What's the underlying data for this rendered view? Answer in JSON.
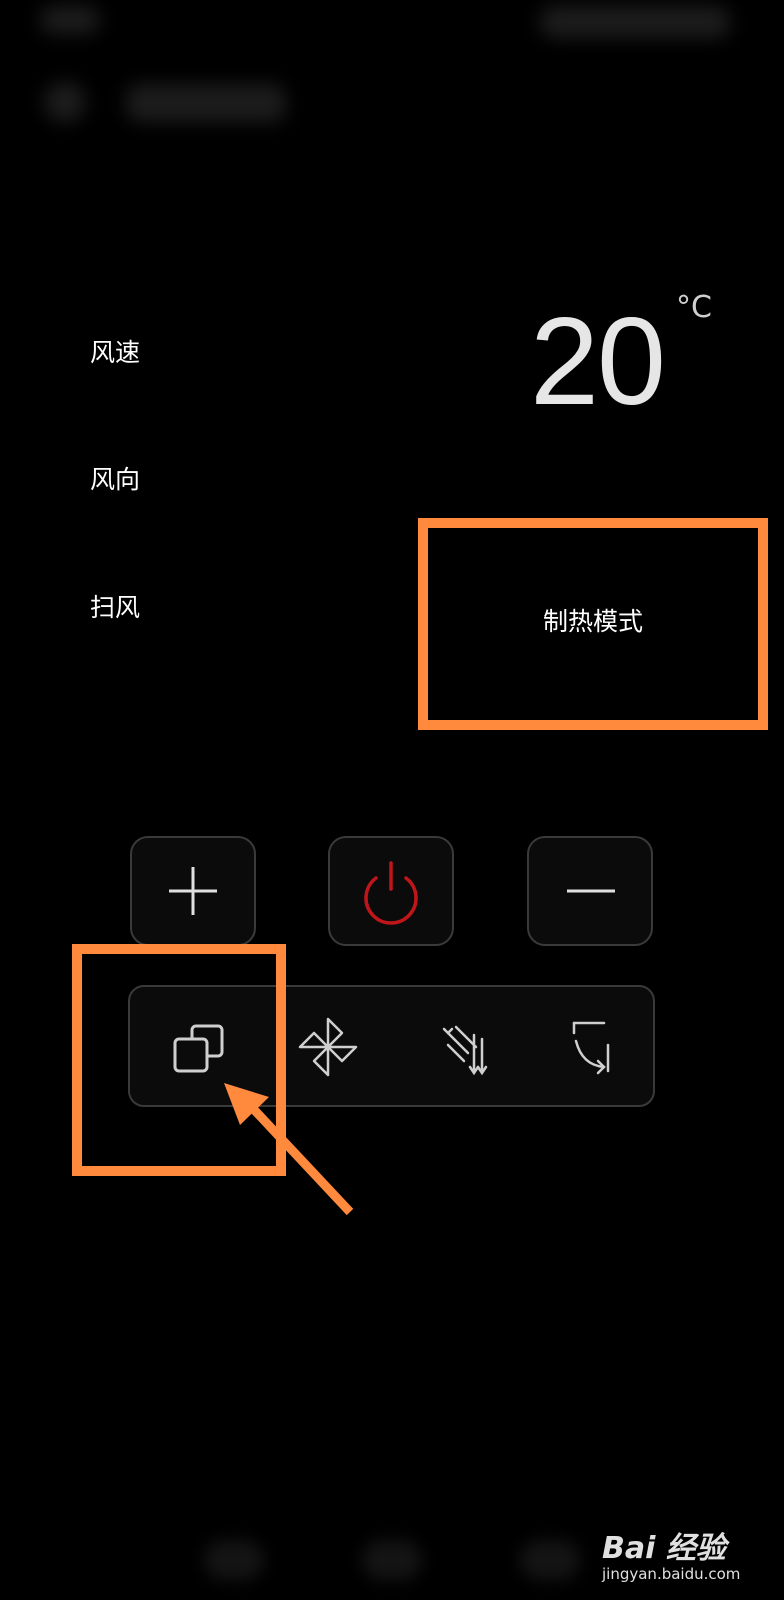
{
  "controls": {
    "fan_speed": "风速",
    "fan_direction": "风向",
    "swing": "扫风"
  },
  "temperature": {
    "value": "20",
    "unit": "°C"
  },
  "mode": {
    "label": "制热模式"
  },
  "buttons": {
    "plus": "plus-icon",
    "power": "power-icon",
    "minus": "minus-icon"
  },
  "functions": [
    "mode-switch-icon",
    "fan-icon",
    "swing-direction-icon",
    "rotate-icon"
  ],
  "colors": {
    "highlight": "#ff8a3d",
    "power": "#c0161a",
    "border": "#3a3a3a"
  },
  "watermark": {
    "brand": "Bai 经验",
    "url": "jingyan.baidu.com"
  }
}
